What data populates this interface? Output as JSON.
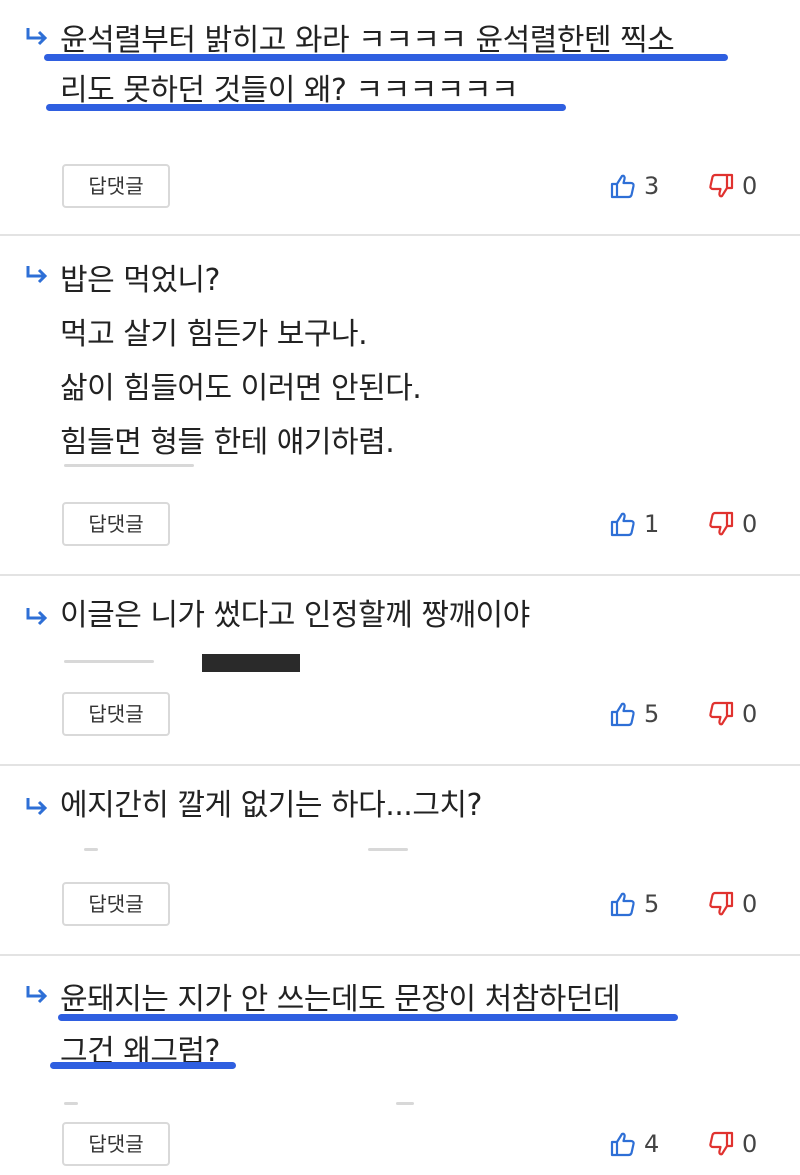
{
  "comments": [
    {
      "lines": [
        "윤석렬부터 밝히고 와라 ㅋㅋㅋㅋ 윤석렬한텐 찍소",
        "리도 못하던 것들이 왜? ㅋㅋㅋㅋㅋㅋ"
      ],
      "reply_label": "답댓글",
      "likes": "3",
      "dislikes": "0"
    },
    {
      "lines": [
        "밥은 먹었니?",
        "먹고 살기 힘든가 보구나.",
        "삶이 힘들어도 이러면 안된다.",
        "힘들면 형들 한테 얘기하렴."
      ],
      "reply_label": "답댓글",
      "likes": "1",
      "dislikes": "0"
    },
    {
      "lines": [
        "이글은 니가 썼다고 인정할께 짱깨이야"
      ],
      "reply_label": "답댓글",
      "likes": "5",
      "dislikes": "0"
    },
    {
      "lines": [
        "에지간히 깔게 없기는 하다...그치?"
      ],
      "reply_label": "답댓글",
      "likes": "5",
      "dislikes": "0"
    },
    {
      "lines": [
        "윤돼지는 지가 안 쓰는데도 문장이 처참하던데",
        "그건 왜그럼?"
      ],
      "reply_label": "답댓글",
      "likes": "4",
      "dislikes": "0"
    }
  ],
  "colors": {
    "accent_underline": "#2f5fe0",
    "like_icon": "#2e6fd6",
    "dislike_icon": "#e0322f",
    "reply_arrow": "#2e6fd6"
  },
  "icons": {
    "reply": "reply-arrow-icon",
    "like": "thumbs-up-icon",
    "dislike": "thumbs-down-icon"
  }
}
